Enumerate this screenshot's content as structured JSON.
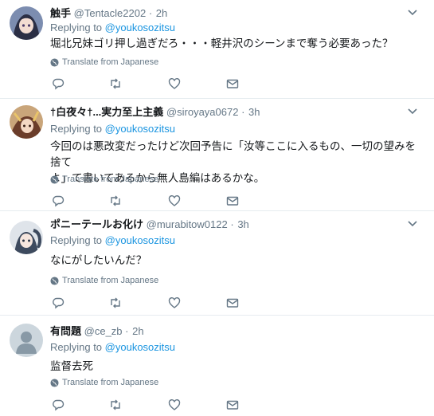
{
  "reply_prefix": "Replying to",
  "translate_label": "Translate from Japanese",
  "tweets": [
    {
      "name": "触手",
      "handle": "@Tentacle2202",
      "time": "2h",
      "reply_to": "@youkosozitsu",
      "lines": [
        "堀北兄妹ゴリ押し過ぎだろ・・・軽井沢のシーンまで奪う必要あった？"
      ]
    },
    {
      "name": "†白夜々†...実力至上主義",
      "handle": "@siroyaya0672",
      "time": "3h",
      "reply_to": "@youkosozitsu",
      "lines": [
        "今回のは悪改変だったけど次回予告に「汝等ここに入るもの、一切の望みを捨て",
        "よ」て書いてあるから無人島編はあるかな。"
      ]
    },
    {
      "name": "ポニーテールお化け",
      "handle": "@murabitow0122",
      "time": "3h",
      "reply_to": "@youkosozitsu",
      "lines": [
        "なにがしたいんだ？"
      ]
    },
    {
      "name": "有問題",
      "handle": "@ce_zb",
      "time": "2h",
      "reply_to": "@youkosozitsu",
      "lines": [
        "监督去死"
      ]
    }
  ]
}
